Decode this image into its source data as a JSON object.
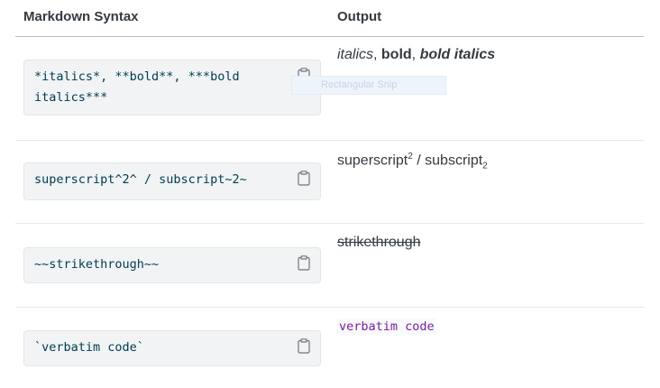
{
  "header": {
    "col1": "Markdown Syntax",
    "col2": "Output"
  },
  "rows": [
    {
      "code_line1": "*italics*, **bold**, ***bold",
      "code_line2": "italics***",
      "out_italic": "italics",
      "out_sep1": ", ",
      "out_bold": "bold",
      "out_sep2": ", ",
      "out_bolditalic": "bold italics"
    },
    {
      "code": "superscript^2^ / subscript~2~",
      "out_base1": "superscript",
      "out_sup": "2",
      "out_mid": " / subscript",
      "out_sub": "2"
    },
    {
      "code": "~~strikethrough~~",
      "out": "strikethrough"
    },
    {
      "code": "`verbatim code`",
      "out": "verbatim code"
    }
  ],
  "overlay": {
    "label": "Rectangular Snip"
  },
  "icons": {
    "copy": "clipboard-icon"
  }
}
